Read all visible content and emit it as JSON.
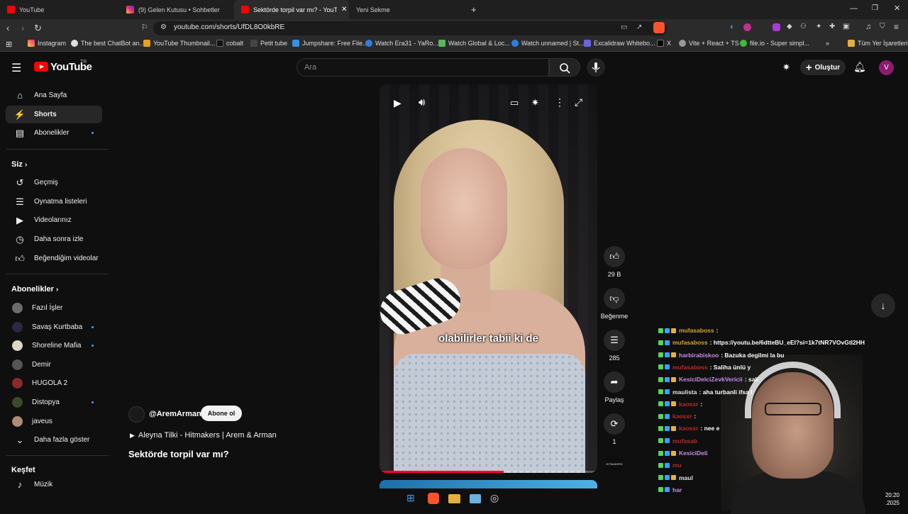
{
  "browser": {
    "tabs": [
      {
        "label": "YouTube",
        "active": false
      },
      {
        "label": "(9) Gelen Kutusu • Sohbetler",
        "active": false
      },
      {
        "label": "Sektörde torpil var mı? - YouTub",
        "active": true
      },
      {
        "label": "Yeni Sekme",
        "active": false
      }
    ],
    "new_tab_icon": "plus-icon",
    "url": "youtube.com/shorts/UfDL8O0kbRE",
    "bookmarks": [
      "Instagram",
      "The best ChatBot an...",
      "YouTube Thumbnail...",
      "cobalt",
      "Petit tube",
      "Jumpshare: Free File...",
      "Watch Era31 - YaRo...",
      "Watch Global & Loc...",
      "Watch unnamed | St...",
      "Excalidraw Whitebo...",
      "X",
      "Vite + React + TS",
      "file.io - Super simpl..."
    ],
    "all_bookmarks": "Tüm Yer İşaretleri",
    "more_bookmarks": "»"
  },
  "youtube": {
    "logo_text": "YouTube",
    "region": "TR",
    "search_placeholder": "Ara",
    "create_label": "Oluştur",
    "avatar_letter": "V",
    "sidebar": {
      "main": [
        {
          "label": "Ana Sayfa",
          "icon": "home-icon"
        },
        {
          "label": "Shorts",
          "icon": "shorts-icon",
          "active": true
        },
        {
          "label": "Abonelikler",
          "icon": "subscriptions-icon",
          "dot": true
        }
      ],
      "you_heading": "Siz",
      "you": [
        {
          "label": "Geçmiş",
          "icon": "history-icon"
        },
        {
          "label": "Oynatma listeleri",
          "icon": "playlists-icon"
        },
        {
          "label": "Videolarınız",
          "icon": "your-videos-icon"
        },
        {
          "label": "Daha sonra izle",
          "icon": "watch-later-icon"
        },
        {
          "label": "Beğendiğim videolar",
          "icon": "liked-videos-icon"
        }
      ],
      "subs_heading": "Abonelikler",
      "subs": [
        {
          "label": "Fazıl İşler",
          "color": "#6b6b6b",
          "dot": false
        },
        {
          "label": "Savaş Kurtbaba",
          "color": "#2a2a40",
          "dot": true
        },
        {
          "label": "Shoreline Mafia",
          "color": "#e0d6c4",
          "dot": true
        },
        {
          "label": "Demir",
          "color": "#555555",
          "dot": false
        },
        {
          "label": "HUGOLA 2",
          "color": "#8a2a2a",
          "dot": false
        },
        {
          "label": "Distopya",
          "color": "#3a4a2a",
          "dot": true
        },
        {
          "label": "javeus",
          "color": "#b08a7a",
          "dot": false
        }
      ],
      "show_more": "Daha fazla göster",
      "explore_heading": "Keşfet",
      "explore": [
        {
          "label": "Müzik",
          "icon": "music-icon"
        }
      ]
    },
    "short": {
      "caption": "olabilirler tabii ki de",
      "progress": 0.57,
      "channel": "@AremArman",
      "subscribe_label": "Abone ol",
      "music": "Aleyna Tilki - Hitmakers | Arem & Arman",
      "title": "Sektörde torpil var mı?",
      "likes": "29 B",
      "dislike_label": "Beğenme",
      "comments": "285",
      "share_label": "Paylaş",
      "remix_count": "1",
      "channel_badge": "HITMAKERS"
    }
  },
  "chat": {
    "lines": [
      {
        "user": "mufasaboss",
        "color": "#d6a23a",
        "msg": ":"
      },
      {
        "user": "mufasaboss",
        "color": "#d6a23a",
        "msg": ": https://youtu.be/6dtteBU_eEI?si=1k7tNR7VOvGtI2HH"
      },
      {
        "user": "harbirabiskoo",
        "color": "#c58ee6",
        "msg": ": Bazuka degilmi la bu"
      },
      {
        "user": "mufasaboss",
        "color": "#b02d2d",
        "msg": ": Saliha ünlü y"
      },
      {
        "user": "KesiciDelciZevkVericii",
        "color": "#c58ee6",
        "msg": ": sali"
      },
      {
        "user": "maulista",
        "color": "#e0e0e0",
        "msg": ": aha turbanli ifsa l"
      },
      {
        "user": "kaosxr",
        "color": "#b02d2d",
        "msg": ":"
      },
      {
        "user": "kaosxr",
        "color": "#b02d2d",
        "msg": ":"
      },
      {
        "user": "kaosxr",
        "color": "#b02d2d",
        "msg": ": nee e"
      },
      {
        "user": "mufasab",
        "color": "#b02d2d",
        "msg": ""
      },
      {
        "user": "KesiciDeli",
        "color": "#c58ee6",
        "msg": ""
      },
      {
        "user": "mu",
        "color": "#b02d2d",
        "msg": ""
      },
      {
        "user": "maul",
        "color": "#e0e0e0",
        "msg": ""
      },
      {
        "user": "har",
        "color": "#c58ee6",
        "msg": ""
      }
    ]
  },
  "taskbar": {
    "time": "20:20",
    "date": ".2025"
  }
}
